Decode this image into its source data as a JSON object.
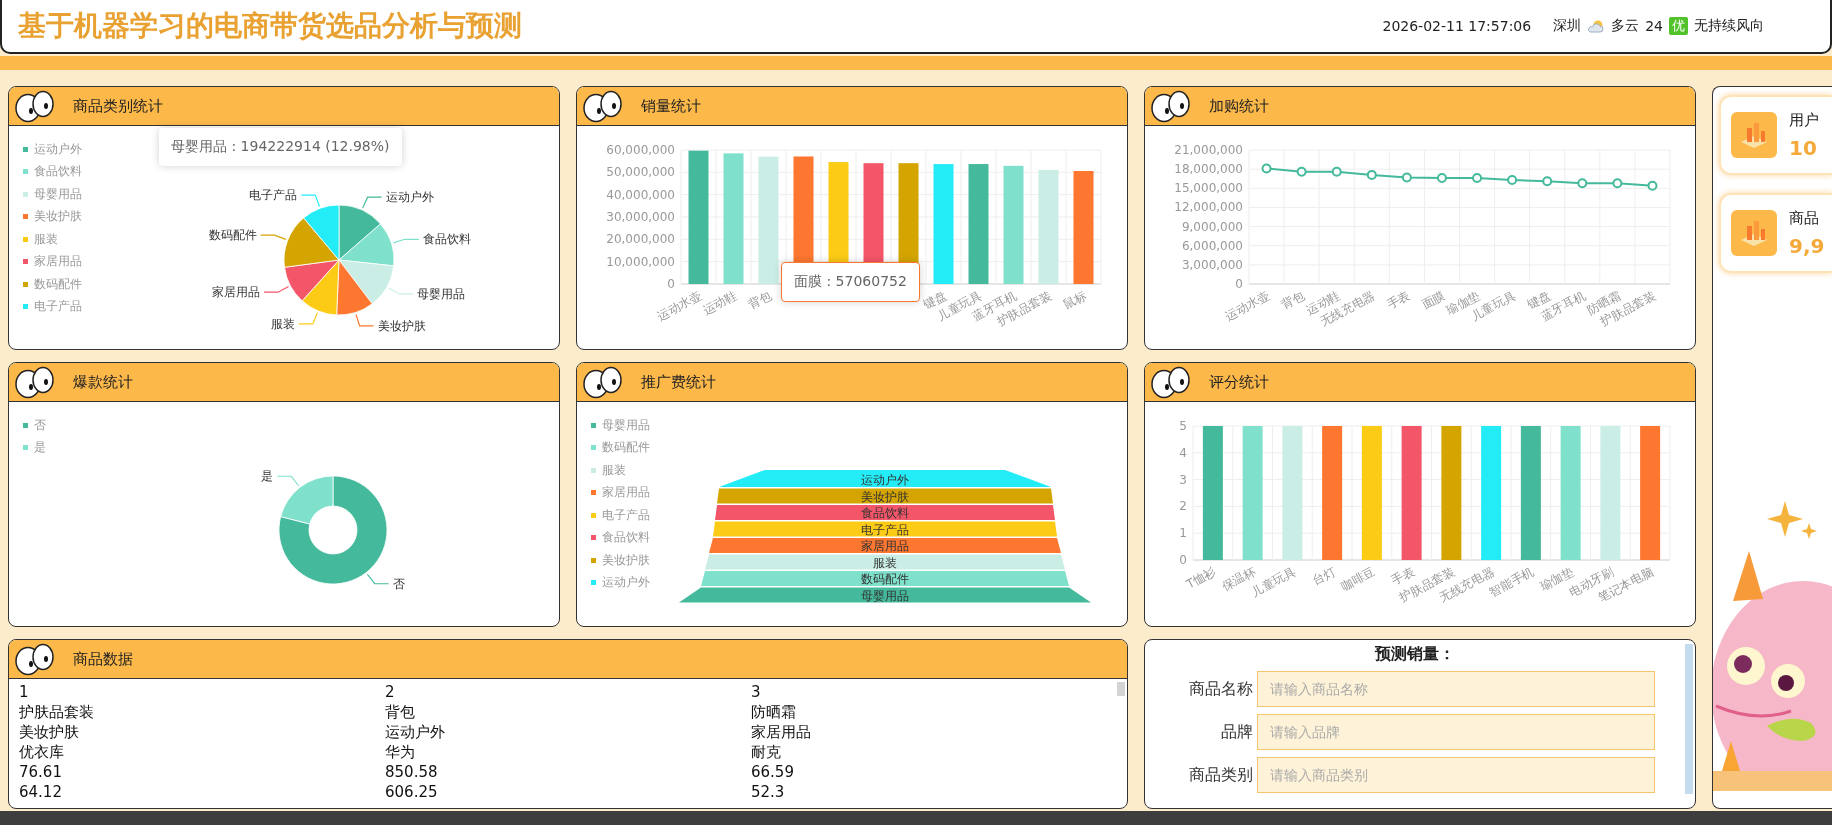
{
  "header": {
    "title": "基于机器学习的电商带货选品分析与预测",
    "datetime": "2026-02-11 17:57:06",
    "city": "深圳",
    "weather": "多云",
    "temperature": "24",
    "air_quality": "优",
    "wind": "无持续风向"
  },
  "category_panel": {
    "title": "商品类别统计",
    "legend": [
      {
        "label": "运动户外",
        "color": "#44b99b"
      },
      {
        "label": "食品饮料",
        "color": "#7fe1cb"
      },
      {
        "label": "母婴用品",
        "color": "#caeee5"
      },
      {
        "label": "美妆护肤",
        "color": "#fd7730"
      },
      {
        "label": "服装",
        "color": "#fccb16"
      },
      {
        "label": "家居用品",
        "color": "#f45669"
      },
      {
        "label": "数码配件",
        "color": "#d4a500"
      },
      {
        "label": "电子产品",
        "color": "#24ecf7"
      }
    ],
    "slice_labels": [
      "运动户外",
      "食品饮料",
      "母婴用品",
      "美妆护肤",
      "服装",
      "家居用品",
      "数码配件",
      "电子产品"
    ],
    "tooltip": "母婴用品 : 194222914 (12.98%)"
  },
  "sales_panel": {
    "title": "销量统计",
    "chart_data": {
      "type": "bar",
      "categories": [
        "运动水壶",
        "运动鞋",
        "背包",
        null,
        null,
        null,
        null,
        "键盘",
        "儿童玩具",
        "蓝牙耳机",
        "护肤品套装",
        "鼠标"
      ],
      "series": [
        {
          "values": [
            59700000,
            58500000,
            57000000,
            57100000,
            54600000,
            54100000,
            54100000,
            53700000,
            53700000,
            52900000,
            51100000,
            50600000
          ]
        }
      ],
      "grid": true,
      "colors": [
        "#44b99b",
        "#7fe1cb",
        "#caeee5",
        "#fd7730",
        "#fccb16",
        "#f45669",
        "#d4a500",
        "#24ecf7",
        "#44b99b",
        "#7fe1cb",
        "#caeee5",
        "#fd7730"
      ],
      "ylim": [
        0,
        60000000
      ],
      "yticks": [
        0,
        {
          "value": 10000000,
          "label": "10,000,000"
        },
        {
          "value": 20000000,
          "label": "20,000,000"
        },
        {
          "value": 30000000,
          "label": "30,000,000"
        },
        {
          "value": 40000000,
          "label": "40,000,000"
        },
        {
          "value": 50000000,
          "label": "50,000,000"
        },
        {
          "value": 60000000,
          "label": "60,000,000"
        }
      ]
    },
    "tooltip": "面膜 : 57060752"
  },
  "cart_panel": {
    "title": "加购统计",
    "chart_data": {
      "type": "line",
      "categories": [
        "运动水壶",
        "背包",
        "运动鞋",
        "无线充电器",
        "手表",
        "面膜",
        "瑜伽垫",
        "儿童玩具",
        "键盘",
        "蓝牙耳机",
        "防晒霜",
        "护肤品套装"
      ],
      "series": [
        {
          "color": "#44b99b",
          "marker": true,
          "values": [
            18100000,
            17600000,
            17600000,
            17100000,
            16700000,
            16600000,
            16600000,
            16300000,
            16100000,
            15800000,
            15800000,
            15400000
          ]
        }
      ],
      "grid": true,
      "ylim": [
        0,
        21000000
      ],
      "yticks": [
        0,
        {
          "value": 3000000,
          "label": "3,000,000"
        },
        {
          "value": 6000000,
          "label": "6,000,000"
        },
        {
          "value": 9000000,
          "label": "9,000,000"
        },
        {
          "value": 12000000,
          "label": "12,000,000"
        },
        {
          "value": 15000000,
          "label": "15,000,000"
        },
        {
          "value": 18000000,
          "label": "18,000,000"
        },
        {
          "value": 21000000,
          "label": "21,000,000"
        }
      ]
    }
  },
  "hot_panel": {
    "title": "爆款统计",
    "legend": [
      {
        "label": "否",
        "color": "#44b99b"
      },
      {
        "label": "是",
        "color": "#7fe1cb"
      }
    ],
    "slice_labels": [
      "否",
      "是"
    ]
  },
  "promo_panel": {
    "title": "推广费统计",
    "legend": [
      {
        "label": "母婴用品",
        "color": "#44b99b"
      },
      {
        "label": "数码配件",
        "color": "#7fe1cb"
      },
      {
        "label": "服装",
        "color": "#caeee5"
      },
      {
        "label": "家居用品",
        "color": "#fd7730"
      },
      {
        "label": "电子产品",
        "color": "#fccb16"
      },
      {
        "label": "食品饮料",
        "color": "#f45669"
      },
      {
        "label": "美妆护肤",
        "color": "#d4a500"
      },
      {
        "label": "运动户外",
        "color": "#24ecf7"
      }
    ],
    "funnel_labels": [
      "运动户外",
      "美妆护肤",
      "食品饮料",
      "电子产品",
      "家居用品",
      "服装",
      "数码配件",
      "母婴用品"
    ]
  },
  "rating_panel": {
    "title": "评分统计",
    "chart_data": {
      "type": "bar",
      "categories": [
        "T恤衫",
        "保温杯",
        "儿童玩具",
        "台灯",
        "咖啡豆",
        "手表",
        "护肤品套装",
        "无线充电器",
        "智能手机",
        "瑜伽垫",
        "电动牙刷",
        "笔记本电脑"
      ],
      "series": [
        {
          "values": [
            5,
            5,
            5,
            5,
            5,
            5,
            5,
            5,
            5,
            5,
            5,
            5
          ]
        }
      ],
      "grid": true,
      "colors": [
        "#44b99b",
        "#7fe1cb",
        "#caeee5",
        "#fd7730",
        "#fccb16",
        "#f45669",
        "#d4a500",
        "#24ecf7",
        "#44b99b",
        "#7fe1cb",
        "#caeee5",
        "#fd7730"
      ],
      "ylim": [
        0,
        5
      ],
      "yticks": [
        0,
        1,
        2,
        3,
        4,
        5
      ]
    }
  },
  "product_panel": {
    "title": "商品数据",
    "records": [
      {
        "fields": [
          "1",
          "护肤品套装",
          "美妆护肤",
          "优衣库",
          "76.61",
          "64.12"
        ]
      },
      {
        "fields": [
          "2",
          "背包",
          "运动户外",
          "华为",
          "850.58",
          "606.25"
        ]
      },
      {
        "fields": [
          "3",
          "防晒霜",
          "家居用品",
          "耐克",
          "66.59",
          "52.3"
        ]
      }
    ]
  },
  "forecast_form": {
    "title": "预测销量：",
    "fields": [
      {
        "label": "商品名称",
        "placeholder": "请输入商品名称"
      },
      {
        "label": "品牌",
        "placeholder": "请输入品牌"
      },
      {
        "label": "商品类别",
        "placeholder": "请输入商品类别"
      }
    ]
  },
  "stat_cards": [
    {
      "label": "用户",
      "value": "10"
    },
    {
      "label": "商品",
      "value": "9,9"
    }
  ]
}
